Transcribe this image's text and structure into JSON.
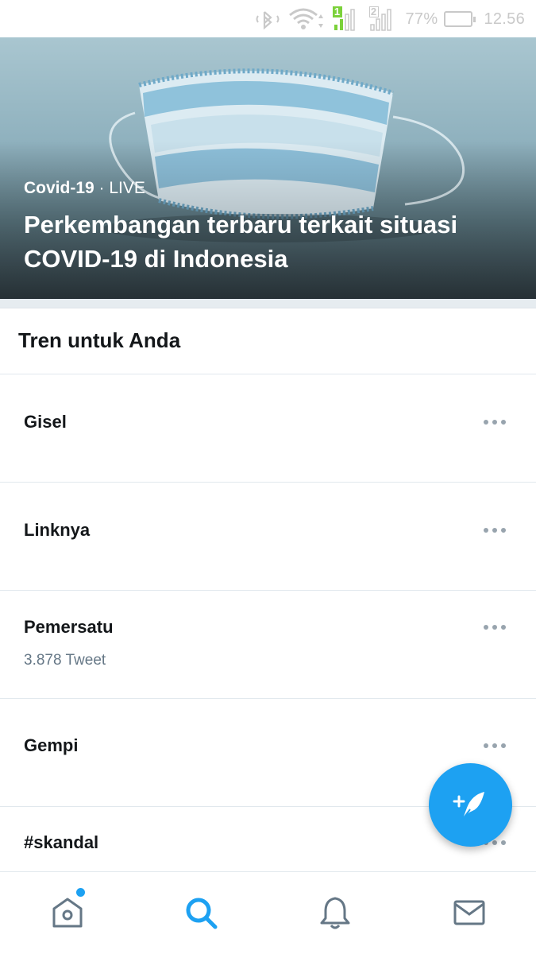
{
  "status_bar": {
    "battery": "77%",
    "time": "12.56",
    "sim1": "1",
    "sim2": "2"
  },
  "hero": {
    "category": "Covid-19",
    "separator": "·",
    "live_label": "LIVE",
    "title": "Perkembangan terbaru terkait situasi COVID-19 di Indonesia"
  },
  "trends": {
    "header": "Tren untuk Anda",
    "items": [
      {
        "name": "Gisel",
        "count": ""
      },
      {
        "name": "Linknya",
        "count": ""
      },
      {
        "name": "Pemersatu",
        "count": "3.878 Tweet"
      },
      {
        "name": "Gempi",
        "count": ""
      },
      {
        "name": "#skandal",
        "count": ""
      }
    ]
  },
  "colors": {
    "accent": "#1da1f2",
    "text_primary": "#14171a",
    "text_secondary": "#657786",
    "divider": "#e1e8ed"
  },
  "icons": {
    "compose": "compose-tweet-icon",
    "home": "home-icon",
    "search": "search-icon",
    "notifications": "bell-icon",
    "messages": "mail-icon",
    "more": "more-dots-icon"
  }
}
